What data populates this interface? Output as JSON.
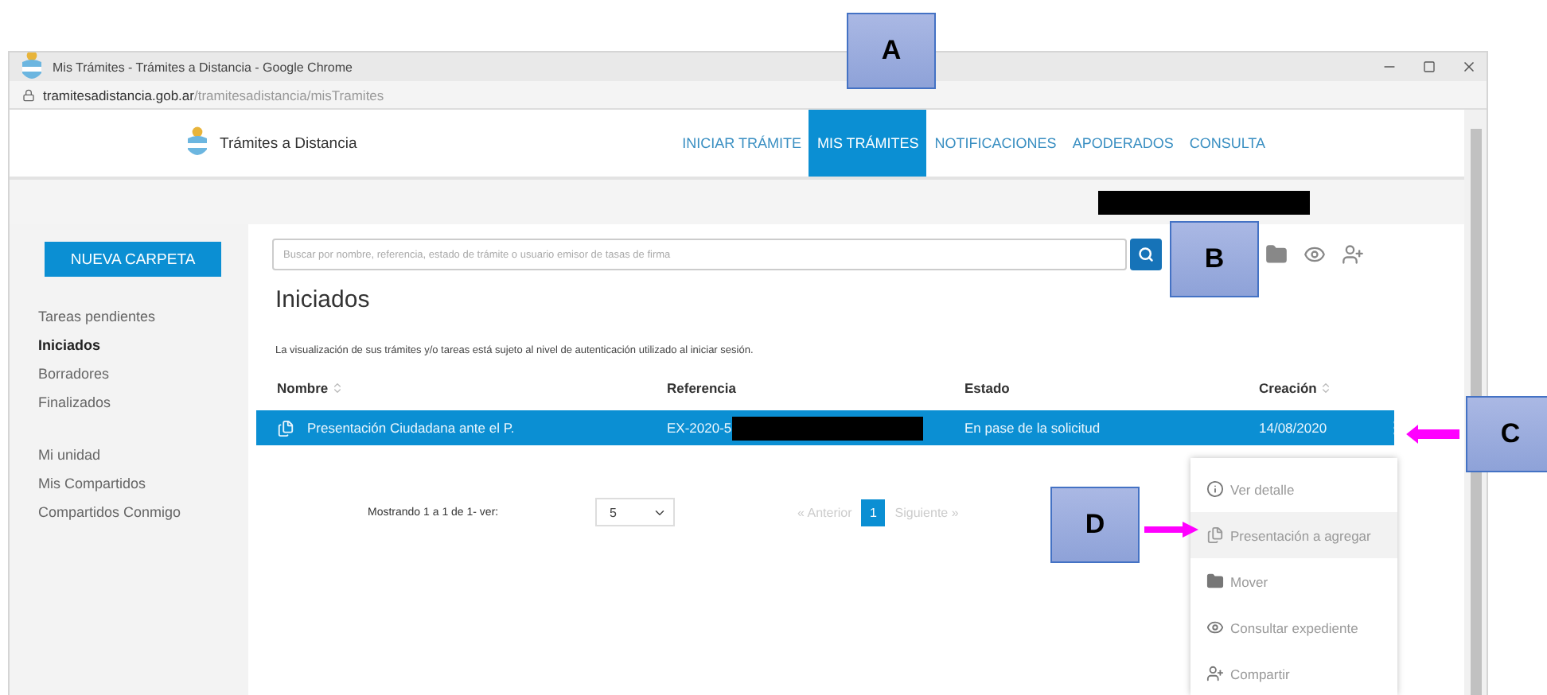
{
  "browser": {
    "title": "Mis Trámites - Trámites a Distancia - Google Chrome",
    "url_host": "tramitesadistancia.gob.ar",
    "url_path": "/tramitesadistancia/misTramites"
  },
  "site": {
    "brand": "Trámites a Distancia",
    "nav": [
      {
        "label": "INICIAR TRÁMITE",
        "selected": false
      },
      {
        "label": "MIS TRÁMITES",
        "selected": true
      },
      {
        "label": "NOTIFICACIONES",
        "selected": false
      },
      {
        "label": "APODERADOS",
        "selected": false
      },
      {
        "label": "CONSULTA",
        "selected": false
      }
    ]
  },
  "sidebar": {
    "new_folder_button": "NUEVA CARPETA",
    "items": [
      {
        "label": "Tareas pendientes",
        "selected": false
      },
      {
        "label": "Iniciados",
        "selected": true
      },
      {
        "label": "Borradores",
        "selected": false
      },
      {
        "label": "Finalizados",
        "selected": false
      }
    ],
    "shared_items": [
      {
        "label": "Mi unidad",
        "selected": false
      },
      {
        "label": "Mis Compartidos",
        "selected": false
      },
      {
        "label": "Compartidos Conmigo",
        "selected": false
      }
    ]
  },
  "search": {
    "placeholder": "Buscar por nombre, referencia, estado de trámite o usuario emisor de tasas de firma"
  },
  "heading": "Iniciados",
  "notice": "La visualización de sus trámites y/o tareas está sujeto al nivel de autenticación utilizado al iniciar sesión.",
  "table": {
    "columns": [
      {
        "label": "Nombre",
        "sortable": true
      },
      {
        "label": "Referencia",
        "sortable": false
      },
      {
        "label": "Estado",
        "sortable": false
      },
      {
        "label": "Creación",
        "sortable": true
      }
    ],
    "rows": [
      {
        "nombre": "Presentación Ciudadana ante el P.",
        "referencia": "EX-2020-5",
        "estado": "En pase de la solicitud",
        "creacion": "14/08/2020",
        "selected": true
      }
    ]
  },
  "pagination": {
    "summary": "Mostrando 1 a 1 de 1- ver:",
    "page_size": "5",
    "previous": "« Anterior",
    "pages": [
      {
        "label": "1",
        "selected": true
      }
    ],
    "next": "Siguiente »"
  },
  "row_menu": {
    "items": [
      {
        "label": "Ver detalle",
        "kind": "info",
        "highlighted": false
      },
      {
        "label": "Presentación a agregar",
        "kind": "files",
        "highlighted": true
      },
      {
        "label": "Mover",
        "kind": "folder",
        "highlighted": false
      },
      {
        "label": "Consultar expediente",
        "kind": "eye",
        "highlighted": false
      },
      {
        "label": "Compartir",
        "kind": "share",
        "highlighted": false
      }
    ]
  },
  "callouts": [
    {
      "label": "A"
    },
    {
      "label": "B"
    },
    {
      "label": "C"
    },
    {
      "label": "D"
    }
  ]
}
